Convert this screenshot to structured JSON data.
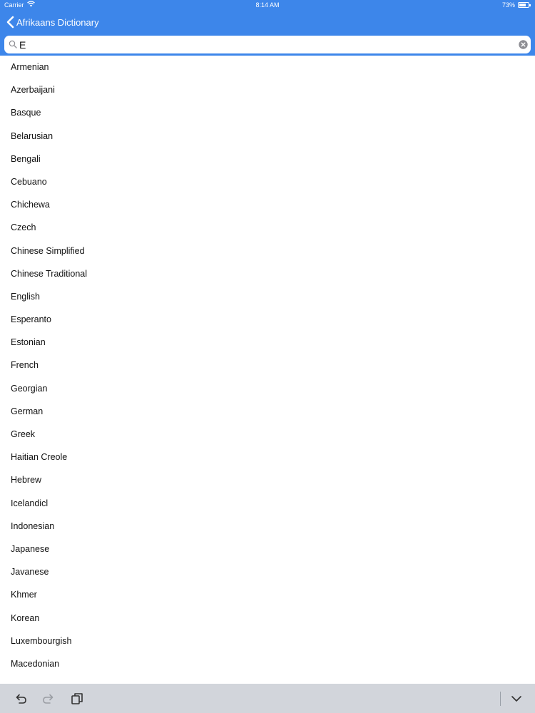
{
  "status_bar": {
    "carrier": "Carrier",
    "time": "8:14 AM",
    "battery": "73%"
  },
  "nav": {
    "back_label": "Afrikaans Dictionary"
  },
  "search": {
    "value": "E",
    "placeholder": ""
  },
  "languages": [
    "Armenian",
    "Azerbaijani",
    "Basque",
    "Belarusian",
    "Bengali",
    "Cebuano",
    "Chichewa",
    "Czech",
    "Chinese Simplified",
    "Chinese Traditional",
    "English",
    "Esperanto",
    "Estonian",
    "French",
    "Georgian",
    "German",
    "Greek",
    "Haitian Creole",
    "Hebrew",
    "Icelandicl",
    "Indonesian",
    "Japanese",
    "Javanese",
    "Khmer",
    "Korean",
    "Luxembourgish",
    "Macedonian"
  ],
  "colors": {
    "accent": "#3d86ea",
    "toolbar": "#d2d5db"
  },
  "toolbar": {
    "icons": [
      "undo-icon",
      "redo-icon",
      "paste-icon",
      "chevron-down-icon"
    ]
  }
}
